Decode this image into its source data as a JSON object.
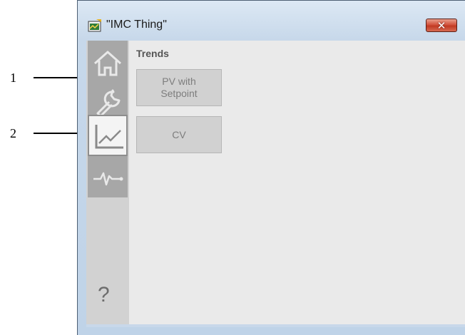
{
  "window": {
    "title": "\"IMC Thing\"",
    "close_label": "✕"
  },
  "callouts": [
    {
      "label": "1"
    },
    {
      "label": "2"
    }
  ],
  "sidebar": {
    "items": [
      {
        "name": "home",
        "icon": "home-icon"
      },
      {
        "name": "maintenance",
        "icon": "wrench-icon"
      },
      {
        "name": "trends",
        "icon": "trend-chart-icon",
        "active": true
      },
      {
        "name": "diagnostics",
        "icon": "pulse-icon"
      }
    ],
    "help_label": "?"
  },
  "trends": {
    "title": "Trends",
    "buttons": [
      {
        "label": "PV with\nSetpoint"
      },
      {
        "label": "CV"
      }
    ]
  },
  "colors": {
    "close_button": "#c13a23",
    "active_tab": "#f4f4f4",
    "inactive_tab": "#a7a7a7"
  }
}
